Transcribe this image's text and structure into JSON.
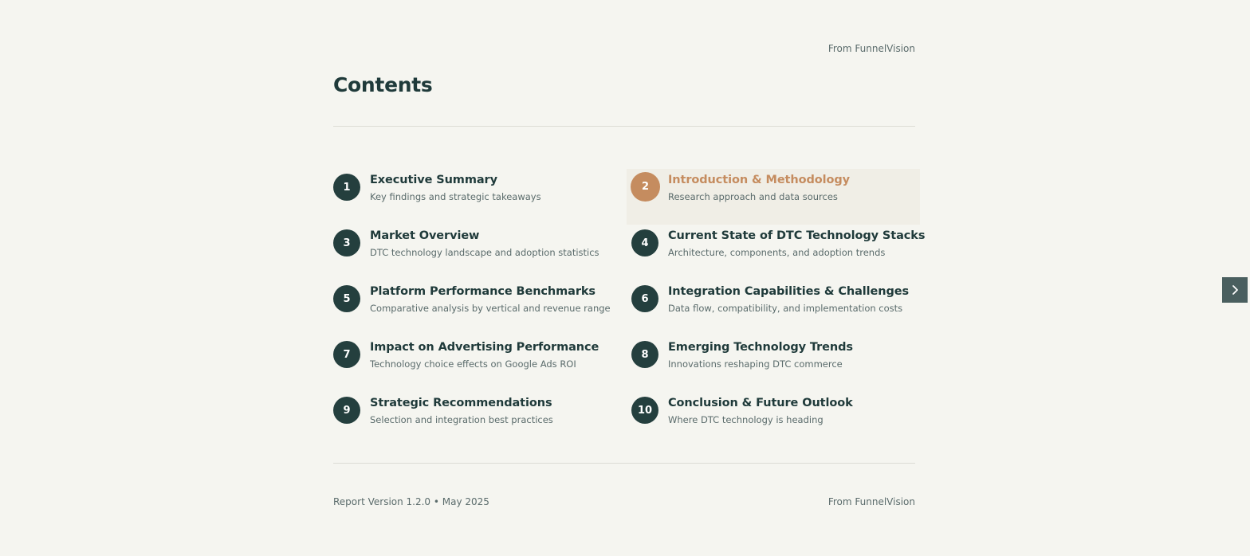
{
  "header": {
    "brand": "From FunnelVision",
    "title": "Contents"
  },
  "toc": {
    "active_index": 1,
    "items": [
      {
        "number": "1",
        "title": "Executive Summary",
        "subtitle": "Key findings and strategic takeaways"
      },
      {
        "number": "2",
        "title": "Introduction & Methodology",
        "subtitle": "Research approach and data sources"
      },
      {
        "number": "3",
        "title": "Market Overview",
        "subtitle": "DTC technology landscape and adoption statistics"
      },
      {
        "number": "4",
        "title": "Current State of DTC Technology Stacks",
        "subtitle": "Architecture, components, and adoption trends"
      },
      {
        "number": "5",
        "title": "Platform Performance Benchmarks",
        "subtitle": "Comparative analysis by vertical and revenue range"
      },
      {
        "number": "6",
        "title": "Integration Capabilities & Challenges",
        "subtitle": "Data flow, compatibility, and implementation costs"
      },
      {
        "number": "7",
        "title": "Impact on Advertising Performance",
        "subtitle": "Technology choice effects on Google Ads ROI"
      },
      {
        "number": "8",
        "title": "Emerging Technology Trends",
        "subtitle": "Innovations reshaping DTC commerce"
      },
      {
        "number": "9",
        "title": "Strategic Recommendations",
        "subtitle": "Selection and integration best practices"
      },
      {
        "number": "10",
        "title": "Conclusion & Future Outlook",
        "subtitle": "Where DTC technology is heading"
      }
    ]
  },
  "footer": {
    "version": "Report Version 1.2.0 • May 2025",
    "brand": "From FunnelVision"
  },
  "nav": {
    "next_icon": "chevron-right-icon"
  },
  "colors": {
    "background": "#f5f5f0",
    "primary": "#243f3e",
    "accent": "#c58c5f",
    "muted_text": "#5a6b6b"
  }
}
